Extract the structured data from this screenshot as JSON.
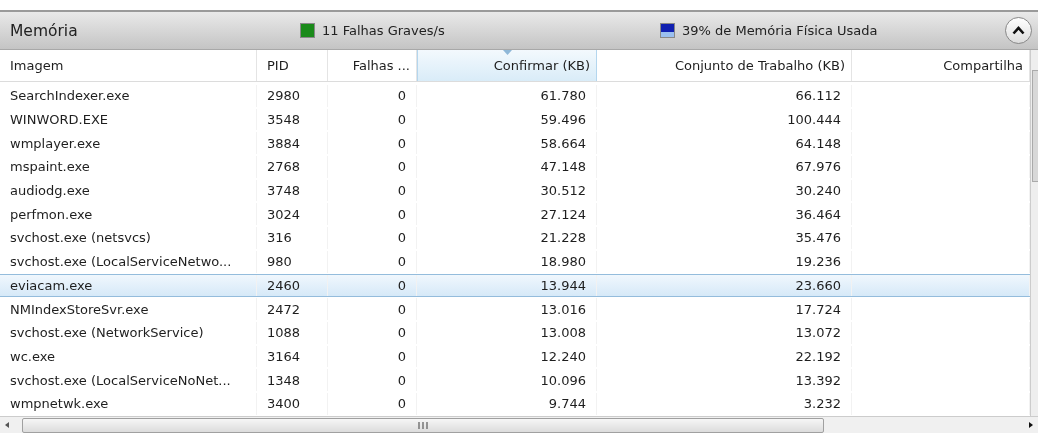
{
  "header": {
    "title": "Memória",
    "indicators": [
      {
        "label": "11 Falhas Graves/s",
        "color": "#1a8a1a"
      },
      {
        "label": "39% de Memória Física Usada",
        "color": "#1020b0"
      }
    ],
    "expanded": true
  },
  "table": {
    "columns": [
      {
        "label": "Imagem",
        "sorted": false
      },
      {
        "label": "PID",
        "sorted": false
      },
      {
        "label": "Falhas ...",
        "sorted": false
      },
      {
        "label": "Confirmar (KB)",
        "sorted": true
      },
      {
        "label": "Conjunto de Trabalho (KB)",
        "sorted": false
      },
      {
        "label": "Compartilha",
        "sorted": false
      }
    ],
    "rows": [
      {
        "cells": [
          "SearchIndexer.exe",
          "2980",
          "0",
          "61.780",
          "66.112"
        ],
        "selected": false
      },
      {
        "cells": [
          "WINWORD.EXE",
          "3548",
          "0",
          "59.496",
          "100.444"
        ],
        "selected": false
      },
      {
        "cells": [
          "wmplayer.exe",
          "3884",
          "0",
          "58.664",
          "64.148"
        ],
        "selected": false
      },
      {
        "cells": [
          "mspaint.exe",
          "2768",
          "0",
          "47.148",
          "67.976"
        ],
        "selected": false
      },
      {
        "cells": [
          "audiodg.exe",
          "3748",
          "0",
          "30.512",
          "30.240"
        ],
        "selected": false
      },
      {
        "cells": [
          "perfmon.exe",
          "3024",
          "0",
          "27.124",
          "36.464"
        ],
        "selected": false
      },
      {
        "cells": [
          "svchost.exe (netsvcs)",
          "316",
          "0",
          "21.228",
          "35.476"
        ],
        "selected": false
      },
      {
        "cells": [
          "svchost.exe (LocalServiceNetwo...",
          "980",
          "0",
          "18.980",
          "19.236"
        ],
        "selected": false
      },
      {
        "cells": [
          "eviacam.exe",
          "2460",
          "0",
          "13.944",
          "23.660"
        ],
        "selected": true
      },
      {
        "cells": [
          "NMIndexStoreSvr.exe",
          "2472",
          "0",
          "13.016",
          "17.724"
        ],
        "selected": false
      },
      {
        "cells": [
          "svchost.exe (NetworkService)",
          "1088",
          "0",
          "13.008",
          "13.072"
        ],
        "selected": false
      },
      {
        "cells": [
          "wc.exe",
          "3164",
          "0",
          "12.240",
          "22.192"
        ],
        "selected": false
      },
      {
        "cells": [
          "svchost.exe (LocalServiceNoNet...",
          "1348",
          "0",
          "10.096",
          "13.392"
        ],
        "selected": false
      },
      {
        "cells": [
          "wmpnetwk.exe",
          "3400",
          "0",
          "9.744",
          "3.232"
        ],
        "selected": false
      }
    ]
  }
}
